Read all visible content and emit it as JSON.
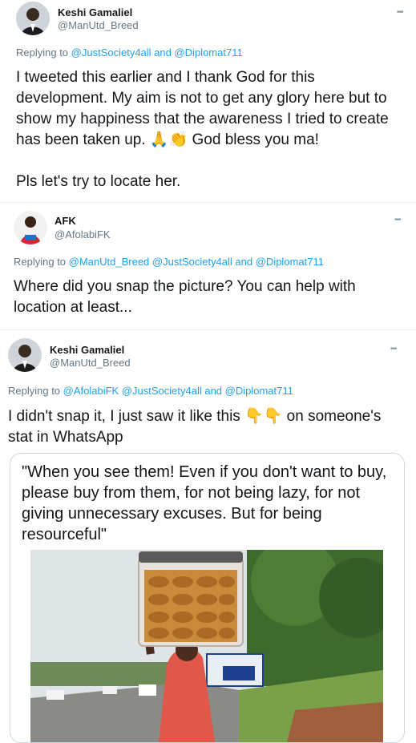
{
  "tweets": [
    {
      "name": "Keshi Gamaliel",
      "handle": "@ManUtd_Breed",
      "more": "•••",
      "replying_prefix": "Replying to ",
      "replying_users": "@JustSociety4all and @Diplomat711",
      "text1": "I tweeted this earlier and I thank God for this development. My aim is not to get any glory here but to show my happiness that the awareness I tried to create has been taken up. 🙏👏 God bless you ma!",
      "text2": "Pls let's try to locate her."
    },
    {
      "name": "AFK",
      "handle": "@AfolabiFK",
      "more": "•••",
      "replying_prefix": "Replying to ",
      "replying_users": "@ManUtd_Breed @JustSociety4all and @Diplomat711",
      "text1": "Where did you snap the picture? You can help with location at least..."
    },
    {
      "name": "Keshi Gamaliel",
      "handle": "@ManUtd_Breed",
      "more": "•••",
      "replying_prefix": "Replying to ",
      "replying_users": "@AfolabiFK @JustSociety4all and @Diplomat711",
      "text1": "I didn't snap it, I just saw it like this 👇👇 on someone's stat in WhatsApp",
      "card_text": "\"When you see them! Even if you don't want to buy, please buy from them, for not being lazy, for not giving unnecessary excuses. But for being resourceful\""
    }
  ],
  "colors": {
    "link": "#1da1f2",
    "muted": "#657786",
    "border": "#e6ecf0"
  }
}
